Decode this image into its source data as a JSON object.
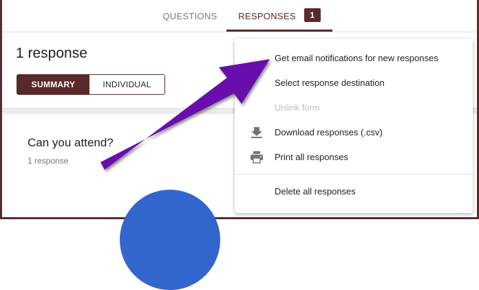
{
  "tabs": {
    "questions_label": "QUESTIONS",
    "responses_label": "RESPONSES",
    "responses_badge": "1"
  },
  "summary": {
    "response_count": "1 response",
    "view_toggle": {
      "summary_label": "SUMMARY",
      "individual_label": "INDIVIDUAL",
      "selected": "SUMMARY"
    }
  },
  "question": {
    "title": "Can you attend?",
    "subtitle": "1 response"
  },
  "menu": {
    "items": [
      {
        "label": "Get email notifications for new responses",
        "icon": "",
        "enabled": true
      },
      {
        "label": "Select response destination",
        "icon": "",
        "enabled": true
      },
      {
        "label": "Unlink form",
        "icon": "",
        "enabled": false
      },
      {
        "label": "Download responses (.csv)",
        "icon": "download-icon",
        "enabled": true
      },
      {
        "label": "Print all responses",
        "icon": "printer-icon",
        "enabled": true
      },
      {
        "label": "Delete all responses",
        "icon": "",
        "enabled": true
      }
    ]
  },
  "colors": {
    "accent": "#5a2a2a",
    "annotation_arrow": "#6a0dad",
    "pie": "#3366cc",
    "disabled_text": "#bdbdbd"
  }
}
